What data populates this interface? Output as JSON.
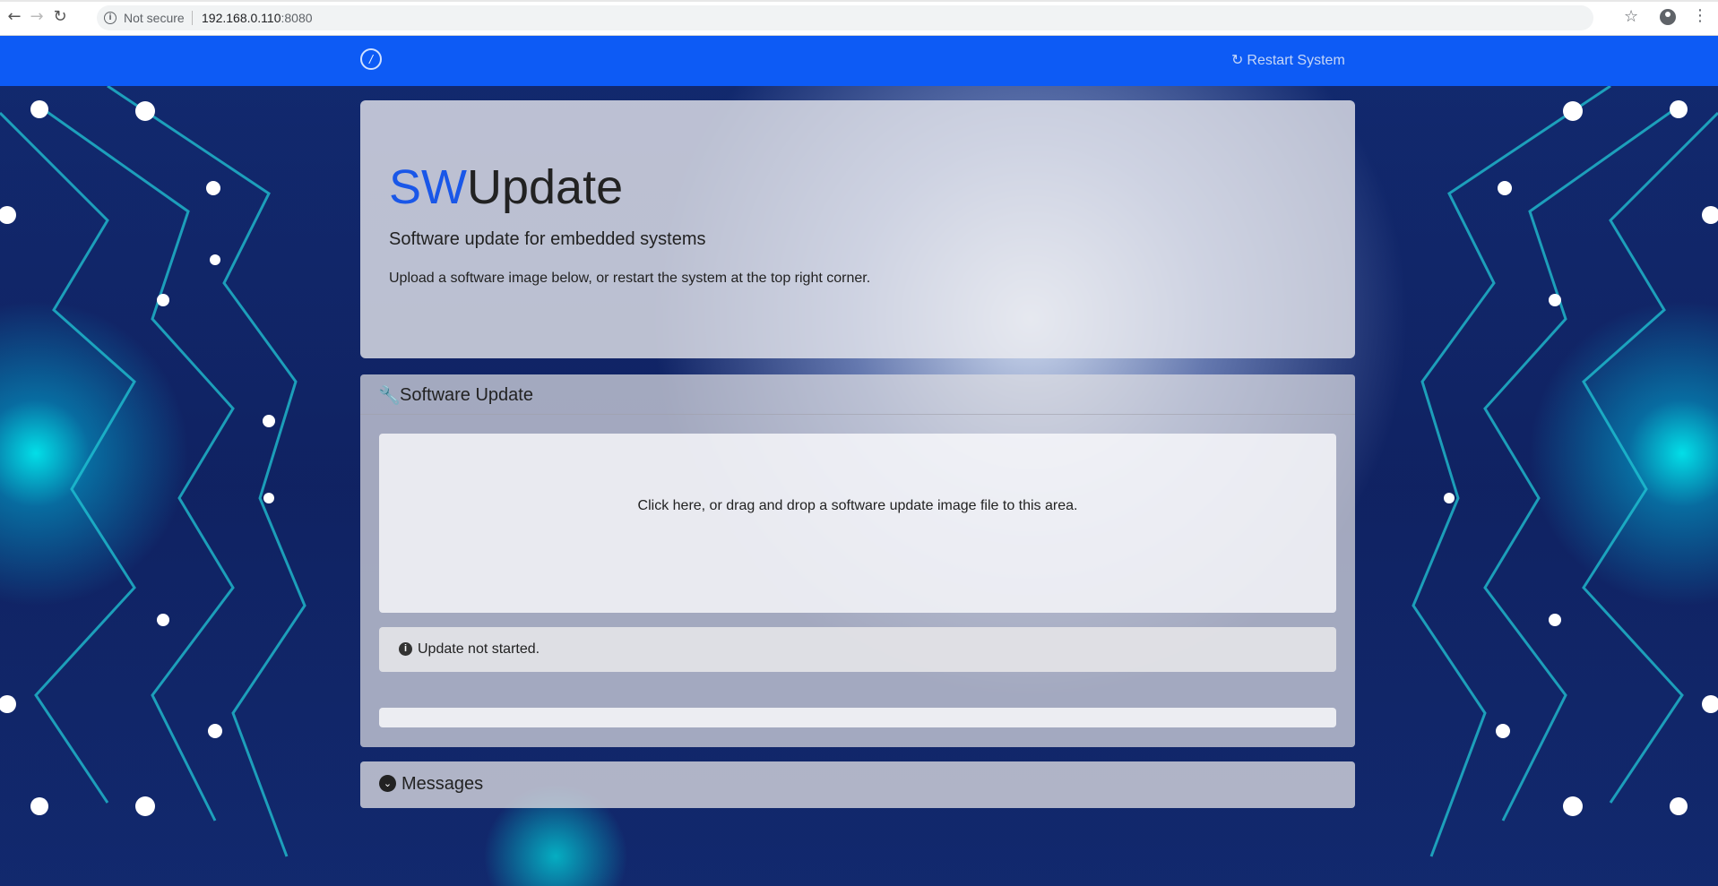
{
  "browser": {
    "security_text": "Not secure",
    "url_host": "192.168.0.110",
    "url_port": ":8080"
  },
  "navbar": {
    "restart_label": "Restart System",
    "brand_color": "#0d5bf5"
  },
  "hero": {
    "title_prefix": "SW",
    "title_suffix": "Update",
    "subtitle": "Software update for embedded systems",
    "lead": "Upload a software image below, or restart the system at the top right corner."
  },
  "update_panel": {
    "heading": "Software Update",
    "dropzone_text": "Click here, or drag and drop a software update image file to this area.",
    "status_text": "Update not started.",
    "progress": 0
  },
  "messages_panel": {
    "heading": "Messages"
  },
  "icons": {
    "info": "info-icon",
    "refresh": "refresh-icon",
    "wrench": "wrench-icon",
    "chevron": "chevron-down-circle-icon"
  }
}
